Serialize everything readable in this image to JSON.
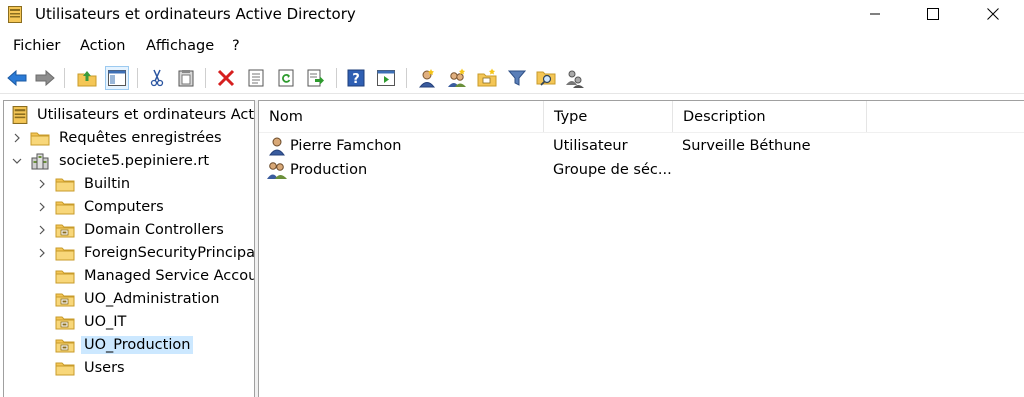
{
  "window": {
    "title": "Utilisateurs et ordinateurs Active Directory"
  },
  "menu": [
    "Fichier",
    "Action",
    "Affichage",
    "?"
  ],
  "toolbar_icons": [
    "back-arrow-icon",
    "forward-arrow-icon",
    "up-folder-icon",
    "show-console-tree-icon",
    "cut-icon",
    "paste-icon",
    "delete-icon",
    "properties-icon",
    "refresh-icon",
    "export-list-icon",
    "help-icon",
    "console-view-icon",
    "new-user-icon",
    "new-group-icon",
    "new-ou-icon",
    "filter-icon",
    "find-icon",
    "add-to-group-icon"
  ],
  "tree": {
    "root": "Utilisateurs et ordinateurs Active Directory",
    "saved_queries": "Requêtes enregistrées",
    "domain": "societe5.pepiniere.rt",
    "children": [
      {
        "label": "Builtin"
      },
      {
        "label": "Computers"
      },
      {
        "label": "Domain Controllers"
      },
      {
        "label": "ForeignSecurityPrincipals"
      },
      {
        "label": "Managed Service Accounts"
      },
      {
        "label": "UO_Administration"
      },
      {
        "label": "UO_IT"
      },
      {
        "label": "UO_Production"
      },
      {
        "label": "Users"
      }
    ],
    "selected": "UO_Production"
  },
  "list": {
    "columns": [
      "Nom",
      "Type",
      "Description"
    ],
    "rows": [
      {
        "name": "Pierre Famchon",
        "type": "Utilisateur",
        "description": "Surveille Béthune",
        "icon": "user-icon"
      },
      {
        "name": "Production",
        "type": "Groupe de séc...",
        "description": "",
        "icon": "group-icon"
      }
    ]
  },
  "colors": {
    "selection": "#cce8ff",
    "folder": "#f4c656",
    "arrow_blue": "#2a7ad6"
  }
}
